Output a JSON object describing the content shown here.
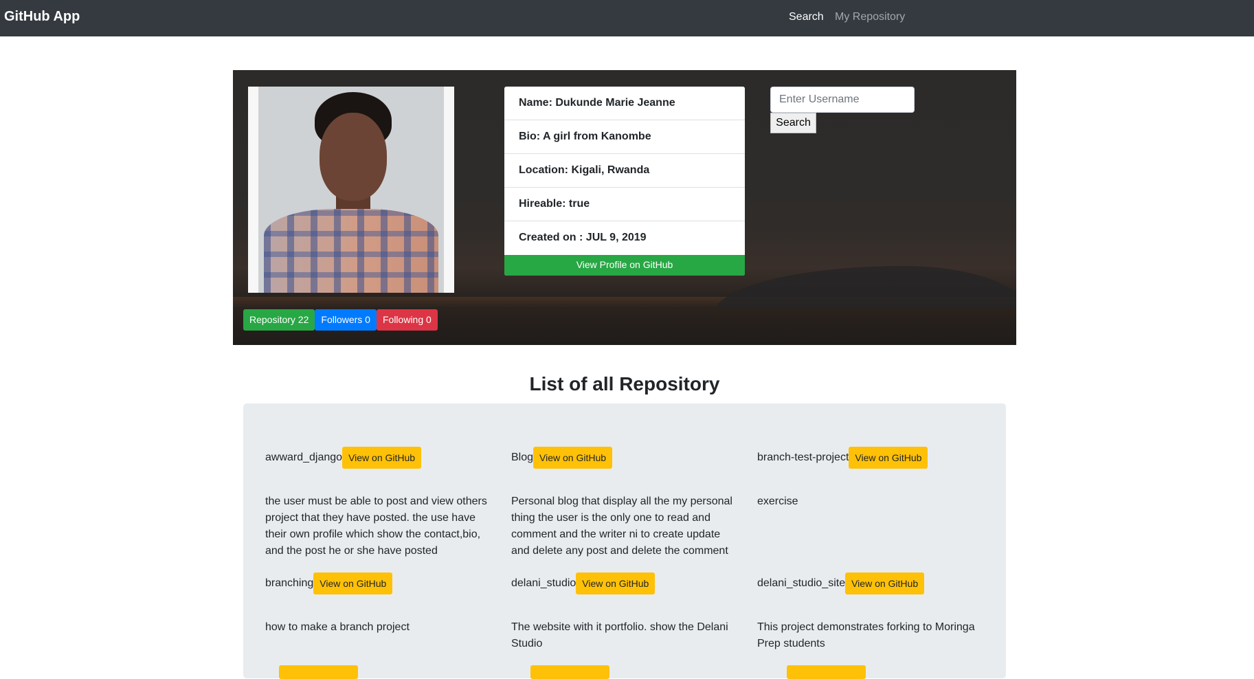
{
  "navbar": {
    "brand": "GitHub App",
    "links": [
      "Search",
      "My Repository"
    ]
  },
  "profile": {
    "avatar_alt": "Profile photo",
    "fields": [
      "Name: Dukunde Marie Jeanne",
      "Bio: A girl from Kanombe",
      "Location: Kigali, Rwanda",
      "Hireable: true",
      "Created on : JUL 9, 2019"
    ],
    "view_profile_label": "View Profile on GitHub",
    "badges": {
      "repository": "Repository 22",
      "followers": "Followers 0",
      "following": "Following 0"
    }
  },
  "search": {
    "placeholder": "Enter Username",
    "button_label": "Search"
  },
  "repositories": {
    "title": "List of all Repository",
    "button_label": "View on GitHub",
    "items": [
      {
        "name": "awward_django",
        "description": "the user must be able to post and view others project that they have posted. the use have their own profile which show the contact,bio, and the post he or she have posted"
      },
      {
        "name": "Blog",
        "description": "Personal blog that display all the my personal thing the user is the only one to read and comment and the writer ni to create update and delete any post and delete the comment"
      },
      {
        "name": "branch-test-project",
        "description": "exercise"
      },
      {
        "name": "branching",
        "description": "how to make a branch project"
      },
      {
        "name": "delani_studio",
        "description": "The website with it portfolio. show the Delani Studio"
      },
      {
        "name": "delani_studio_site",
        "description": "This project demonstrates forking to Moringa Prep students"
      }
    ]
  },
  "colors": {
    "navbar": "#343a40",
    "success": "#28a745",
    "primary": "#007bff",
    "danger": "#dc3545",
    "warning": "#ffc107",
    "panel": "#e9ecef"
  }
}
